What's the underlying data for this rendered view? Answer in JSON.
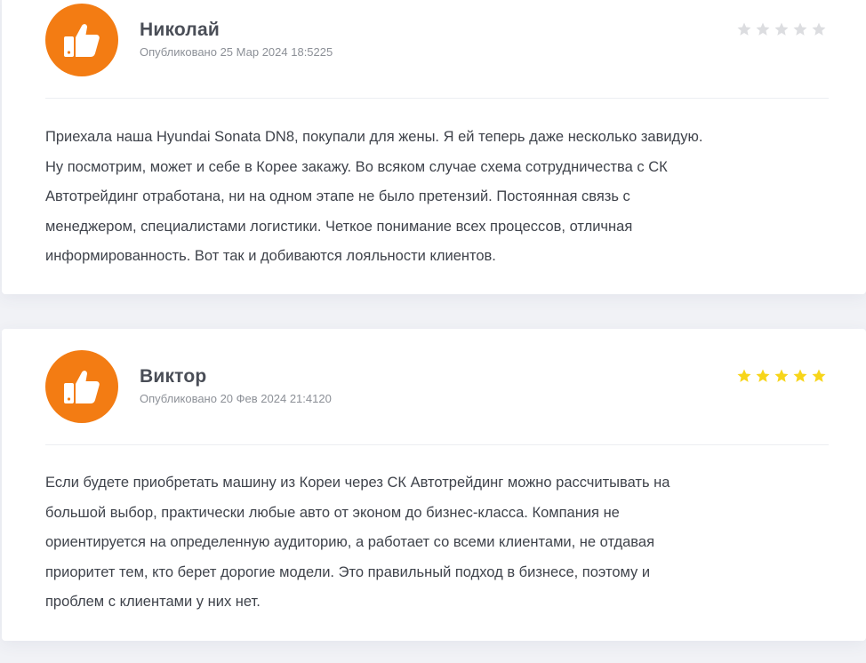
{
  "reviews": [
    {
      "author": "Николай",
      "published": "Опубликовано 25 Мар 2024 18:5225",
      "rating": 0,
      "max_rating": 5,
      "avatar_icon": "thumbs-up-icon",
      "avatar_color": "#f37c13",
      "text_lines": [
        "Приехала наша Hyundai Sonata DN8, покупали для жены. Я ей теперь даже несколько завидую.",
        "Ну посмотрим, может и себе в Корее закажу. Во всяком случае схема сотрудничества с СК",
        "Автотрейдинг отработана, ни на одном этапе не было претензий. Постоянная связь с",
        "менеджером, специалистами логистики. Четкое понимание всех процессов, отличная",
        "информированность. Вот так и добиваются лояльности клиентов."
      ]
    },
    {
      "author": "Виктор",
      "published": "Опубликовано 20 Фев 2024 21:4120",
      "rating": 5,
      "max_rating": 5,
      "avatar_icon": "thumbs-up-icon",
      "avatar_color": "#f37c13",
      "text_lines": [
        "Если будете приобретать машину из Кореи через СК Автотрейдинг можно рассчитывать на",
        "большой выбор, практически любые авто от эконом до бизнес-класса. Компания не",
        "ориентируется на определенную аудиторию, а работает со всеми клиентами, не отдавая",
        "приоритет тем, кто берет дорогие модели. Это правильный подход в бизнесе, поэтому и",
        "проблем с клиентами у них нет."
      ]
    }
  ],
  "colors": {
    "star_filled": "#f7d51a",
    "star_empty": "#dcdde0",
    "page_background": "#f1f2f6"
  }
}
